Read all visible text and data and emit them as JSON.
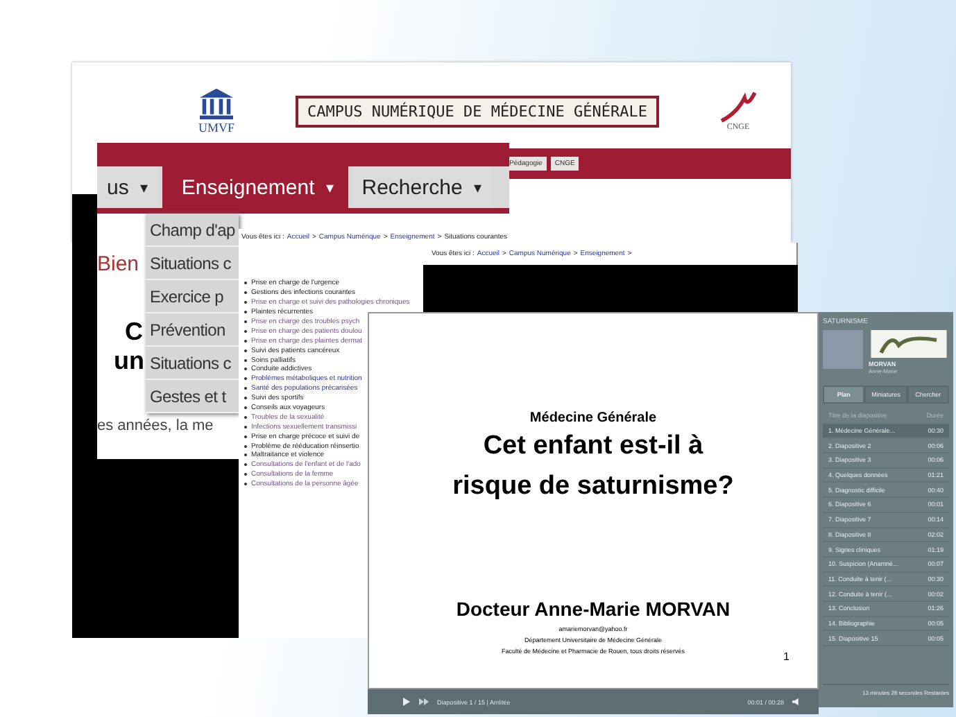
{
  "site_header": {
    "title": "CAMPUS NUMÉRIQUE DE MÉDECINE GÉNÉRALE",
    "left_logo": "UMVF",
    "right_logo": "CNGE",
    "nav_items": [
      {
        "label": "Pédagogie"
      },
      {
        "label": "CNGE"
      }
    ]
  },
  "zoomed_site": {
    "nav_tabs": [
      {
        "label": "us",
        "caret": "▾",
        "selected": false
      },
      {
        "label": "Enseignement",
        "caret": "▾",
        "selected": true
      },
      {
        "label": "Recherche",
        "caret": "▾",
        "selected": false
      }
    ],
    "dropdown": [
      "Champ d'ap",
      "Situations c",
      "Exercice p",
      "Prévention",
      "Situations c",
      "Gestes et t"
    ],
    "welcome": "Bien",
    "heading_1": "C",
    "heading_2": "un",
    "body_text": "es années, la me"
  },
  "list_page": {
    "breadcrumb": [
      {
        "label": "Vous êtes ici :",
        "kind": "plain"
      },
      {
        "label": "Accueil",
        "kind": "link"
      },
      {
        "label": ">",
        "kind": "separator"
      },
      {
        "label": "Campus Numérique",
        "kind": "link"
      },
      {
        "label": ">",
        "kind": "separator"
      },
      {
        "label": "Enseignement",
        "kind": "link"
      },
      {
        "label": ">",
        "kind": "separator"
      },
      {
        "label": "Situations courantes",
        "kind": "plain"
      }
    ],
    "items": [
      {
        "label": "Prise en charge de l'urgence",
        "kind": "plain"
      },
      {
        "label": "Gestions des infections courantes",
        "kind": "plain"
      },
      {
        "label": "Prise en charge et suivi des pathologies chroniques",
        "kind": "visited"
      },
      {
        "label": "Plaintes récurrentes",
        "kind": "plain"
      },
      {
        "label": "Prise en charge des troubles psych",
        "kind": "visited"
      },
      {
        "label": "Prise en charge des patients doulou",
        "kind": "visited"
      },
      {
        "label": "Prise en charge des plaintes dermat",
        "kind": "visited"
      },
      {
        "label": "Suivi des patients cancéreux",
        "kind": "plain"
      },
      {
        "label": "Soins palliatifs",
        "kind": "plain"
      },
      {
        "label": "Conduite addictives",
        "kind": "plain"
      },
      {
        "label": "Problèmes métaboliques et nutrition",
        "kind": "link"
      },
      {
        "label": "Santé des populations précarisées",
        "kind": "link"
      },
      {
        "label": "Suivi des sportifs",
        "kind": "plain"
      },
      {
        "label": "Conseils aux voyageurs",
        "kind": "plain"
      },
      {
        "label": "Troubles de la sexualité",
        "kind": "visited"
      },
      {
        "label": "Infections sexuellement transmissi",
        "kind": "visited"
      },
      {
        "label": "Prise en charge précoce et suivi de",
        "kind": "plain"
      },
      {
        "label": "Problème de rééducation réinsertio",
        "kind": "plain"
      },
      {
        "label": "Maltraitance et violence",
        "kind": "plain"
      },
      {
        "label": "Consultations de l'enfant et de l'ado",
        "kind": "visited"
      },
      {
        "label": "Consultations de la femme",
        "kind": "visited"
      },
      {
        "label": "Consultations de la personne âgée",
        "kind": "visited"
      }
    ]
  },
  "second_page": {
    "breadcrumb": [
      {
        "label": "Vous êtes ici :",
        "kind": "plain"
      },
      {
        "label": "Accueil",
        "kind": "link"
      },
      {
        "label": ">",
        "kind": "separator"
      },
      {
        "label": "Campus Numérique",
        "kind": "link"
      },
      {
        "label": ">",
        "kind": "separator"
      },
      {
        "label": "Enseignement",
        "kind": "link"
      },
      {
        "label": ">",
        "kind": "separator"
      }
    ]
  },
  "player": {
    "slide": {
      "subtitle": "Médecine Générale",
      "title_1": "Cet enfant est-il à",
      "title_2": "risque de saturnisme?",
      "author": "Docteur Anne-Marie MORVAN",
      "email": "amariemorvan@yahoo.fr",
      "department": "Département Universitaire de Médecine Générale",
      "faculty": "Faculté de Médecine et Pharmacie de Rouen, tous droits réservés",
      "page_number": "1"
    },
    "control_bar": {
      "status": "Diapositive 1 / 15 | Arrêtée",
      "time": "00:01 / 00:28"
    }
  },
  "sidebar": {
    "title": "SATURNISME",
    "presenter": "MORVAN",
    "presenter_first": "Anne-Marie",
    "tabs": [
      {
        "label": "Plan",
        "selected": true
      },
      {
        "label": "Miniatures",
        "selected": false
      },
      {
        "label": "Chercher",
        "selected": false
      }
    ],
    "columns": [
      "Titre de la diapositive",
      "Durée"
    ],
    "slides": [
      {
        "title": "1. Médecine Générale...",
        "duration": "00:30",
        "selected": true
      },
      {
        "title": "2. Diapositive 2",
        "duration": "00:06",
        "selected": false
      },
      {
        "title": "3. Diapositive 3",
        "duration": "00:06",
        "selected": false
      },
      {
        "title": "4. Quelques données",
        "duration": "01:21",
        "selected": false
      },
      {
        "title": "5. Diagnostic difficile",
        "duration": "00:40",
        "selected": false
      },
      {
        "title": "6. Diapositive 6",
        "duration": "00:01",
        "selected": false
      },
      {
        "title": "7. Diapositive 7",
        "duration": "00:14",
        "selected": false
      },
      {
        "title": "8. Diapositive 8",
        "duration": "02:02",
        "selected": false
      },
      {
        "title": "9. Signes cliniques",
        "duration": "01:19",
        "selected": false
      },
      {
        "title": "10. Suspicion (Anamnè...",
        "duration": "00:07",
        "selected": false
      },
      {
        "title": "11. Conduite à tenir (...",
        "duration": "00:30",
        "selected": false
      },
      {
        "title": "12. Conduite à tenir (...",
        "duration": "00:02",
        "selected": false
      },
      {
        "title": "13. Conclusion",
        "duration": "01:26",
        "selected": false
      },
      {
        "title": "14. Bibliographie",
        "duration": "00:05",
        "selected": false
      },
      {
        "title": "15. Diapositive 15",
        "duration": "00:05",
        "selected": false
      }
    ],
    "footer": "13 minutes 28 secondes Restantes"
  }
}
